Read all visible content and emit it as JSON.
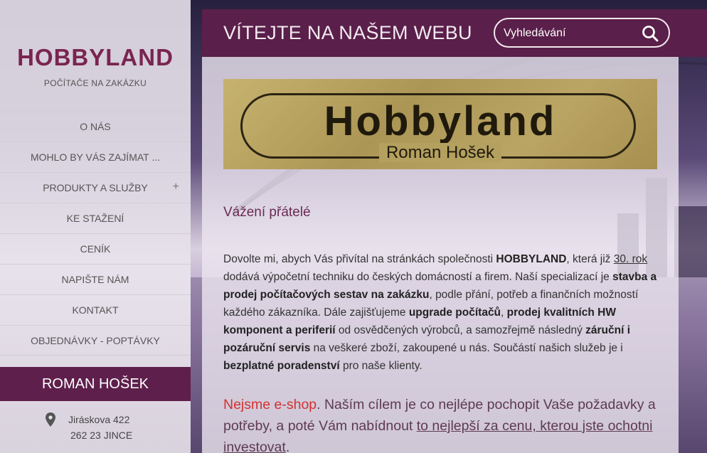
{
  "site": {
    "title": "HOBBYLAND",
    "subtitle": "POČÍTAČE NA ZAKÁZKU"
  },
  "menu": [
    {
      "label": "O NÁS",
      "name": "menu-item-o-nas",
      "expandable": false
    },
    {
      "label": "MOHLO BY VÁS ZAJÍMAT ...",
      "name": "menu-item-mohlo-by-vas-zajimat",
      "expandable": false
    },
    {
      "label": "PRODUKTY A SLUŽBY",
      "name": "menu-item-produkty-a-sluzby",
      "expandable": true
    },
    {
      "label": "KE STAŽENÍ",
      "name": "menu-item-ke-stazeni",
      "expandable": false
    },
    {
      "label": "CENÍK",
      "name": "menu-item-cenik",
      "expandable": false
    },
    {
      "label": "NAPIŠTE NÁM",
      "name": "menu-item-napiste-nam",
      "expandable": false
    },
    {
      "label": "KONTAKT",
      "name": "menu-item-kontakt",
      "expandable": false
    },
    {
      "label": "OBJEDNÁVKY - POPTÁVKY",
      "name": "menu-item-objednavky-poptavky",
      "expandable": false
    }
  ],
  "menu_expand_symbol": "+",
  "contact": {
    "heading": "ROMAN HOŠEK",
    "street": "Jiráskova 422",
    "city": "262 23 JINCE",
    "icon": "map-pin-icon"
  },
  "header": {
    "title": "VÍTEJTE NA NAŠEM WEBU",
    "search_placeholder": "Vyhledávání",
    "search_icon": "search-icon"
  },
  "banner": {
    "name": "Hobbyland",
    "owner": "Roman Hošek"
  },
  "content": {
    "greeting": "Vážení přátelé",
    "intro": {
      "p1": "Dovolte mi, abych Vás přivítal na stránkách společnosti ",
      "b1": "HOBBYLAND",
      "p2": ", která již ",
      "link1": "30. rok",
      "p3": " dodává výpočetní techniku do českých domácností a firem. Naší specializací je ",
      "b2": "stavba a prodej počítačových sestav na zakázku",
      "p4": ", podle přání, potřeb a finančních možností každého zákazníka. Dále zajišťujeme ",
      "b3": "upgrade počítačů",
      "p5": ", ",
      "b4": "prodej kvalitních HW komponent a periferií",
      "p6": " od osvědčených výrobců, a samozřejmě následný ",
      "b5": "záruční i pozáruční servis",
      "p7": " na veškeré zboží, zakoupené u nás. Součástí našich služeb je i ",
      "b6": "bezplatné poradenství",
      "p8": " pro naše klienty."
    },
    "eshop": {
      "red": "Nejsme e-shop",
      "t1": ". Naším cílem je co nejlépe pochopit Vaše požadavky a potřeby, a poté Vám nabídnout ",
      "link": " to nejlepší za cenu, kterou jste ochotni investovat",
      "t2": "."
    }
  },
  "colors": {
    "brand": "#7a2450",
    "header_bg": "#5a1f4a",
    "accent_red": "#d2332f"
  }
}
